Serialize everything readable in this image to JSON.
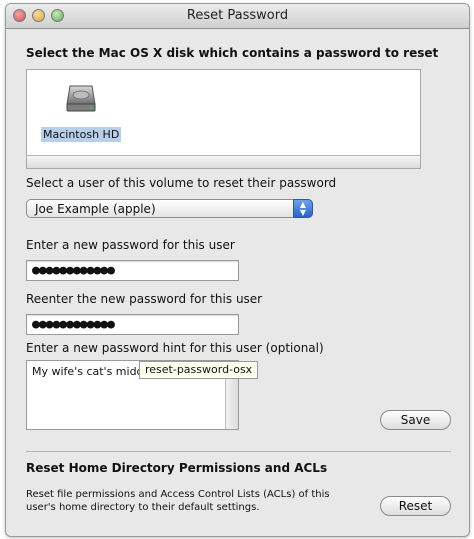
{
  "window": {
    "title": "Reset Password"
  },
  "disk_section": {
    "label": "Select the Mac OS X disk which contains a password to reset",
    "disks": [
      {
        "name": "Macintosh HD",
        "icon": "hard-drive-icon",
        "selected": true
      }
    ]
  },
  "user_section": {
    "label": "Select a user of this volume to reset their password",
    "selected_user": "Joe Example (apple)"
  },
  "password": {
    "label": "Enter a new password for this user",
    "value": "●●●●●●●●●●●●"
  },
  "password_confirm": {
    "label": "Reenter the new password for this user",
    "value": "●●●●●●●●●●●●"
  },
  "hint": {
    "label": "Enter a new password hint for this user (optional)",
    "value": "My wife's cat's midd"
  },
  "tooltip": {
    "text": "reset-password-osx"
  },
  "save_label": "Save",
  "acl_section": {
    "title": "Reset Home Directory Permissions and ACLs",
    "description_line1": "Reset file permissions and Access Control Lists (ACLs) of this",
    "description_line2": "user's home directory to their default settings.",
    "reset_label": "Reset"
  },
  "colors": {
    "selection": "#b8cfea",
    "popup_accent": "#2a63c8"
  }
}
